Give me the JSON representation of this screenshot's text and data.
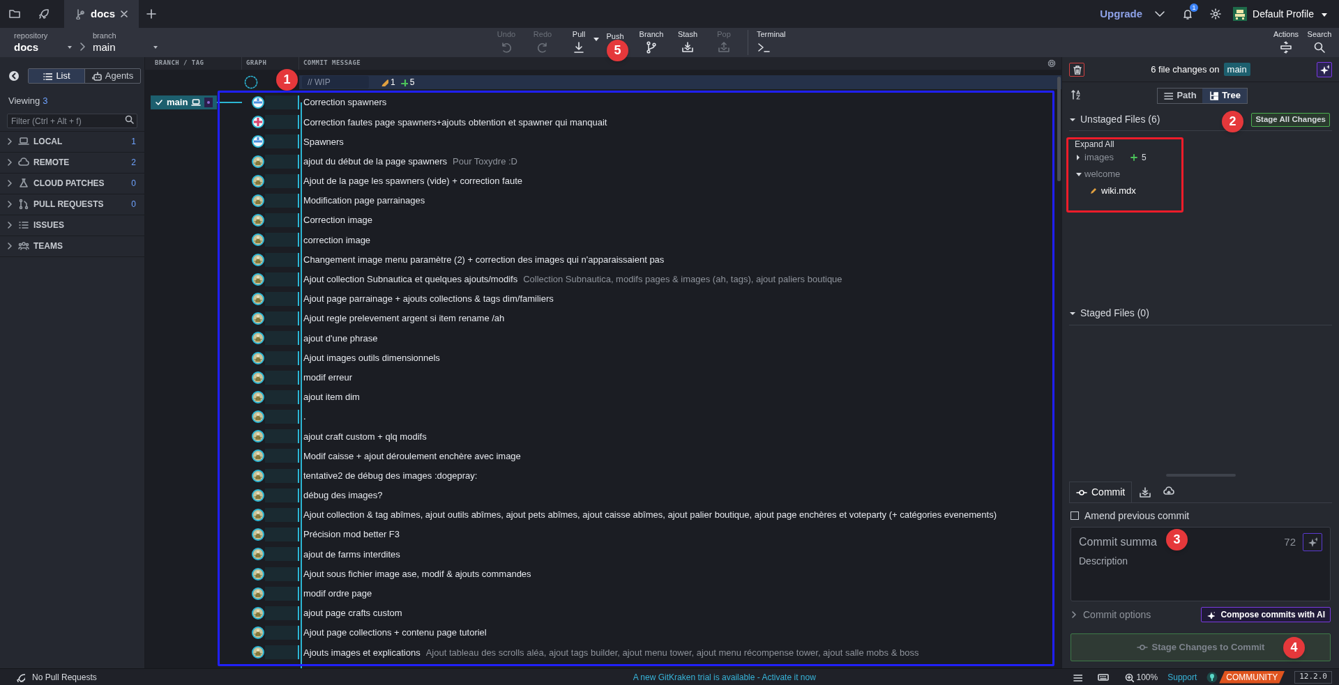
{
  "top_bar": {
    "tabs": [
      {
        "label": "docs",
        "selected": true
      }
    ],
    "upgrade": "Upgrade",
    "notifications": "1",
    "profile": "Default Profile"
  },
  "toolbar": {
    "repository_label": "repository",
    "repository": "docs",
    "branch_label": "branch",
    "branch": "main",
    "actions": [
      {
        "label": "Undo",
        "kind": "undo",
        "disabled": true
      },
      {
        "label": "Redo",
        "kind": "redo",
        "disabled": true
      },
      {
        "label": "Pull",
        "kind": "pull",
        "disabled": false
      },
      {
        "label": "Push",
        "kind": "push",
        "disabled": false
      },
      {
        "label": "Branch",
        "kind": "branch",
        "disabled": false
      },
      {
        "label": "Stash",
        "kind": "stash",
        "disabled": false
      },
      {
        "label": "Pop",
        "kind": "pop",
        "disabled": true
      },
      {
        "label": "Terminal",
        "kind": "terminal",
        "disabled": false
      }
    ],
    "right_actions": [
      {
        "label": "Actions",
        "kind": "actions"
      },
      {
        "label": "Search",
        "kind": "search"
      }
    ]
  },
  "sidebar": {
    "view_tabs": [
      {
        "label": "List",
        "selected": true
      },
      {
        "label": "Agents",
        "selected": false
      }
    ],
    "viewing_label": "Viewing",
    "viewing_count": "3",
    "filter_placeholder": "Filter (Ctrl + Alt + f)",
    "sections": [
      {
        "label": "LOCAL",
        "kind": "local",
        "count": "1"
      },
      {
        "label": "REMOTE",
        "kind": "remote",
        "count": "2"
      },
      {
        "label": "CLOUD PATCHES",
        "kind": "cloud",
        "count": "0"
      },
      {
        "label": "PULL REQUESTS",
        "kind": "pr",
        "count": "0"
      },
      {
        "label": "ISSUES",
        "kind": "issues"
      },
      {
        "label": "TEAMS",
        "kind": "teams"
      }
    ]
  },
  "graph": {
    "columns": [
      "BRANCH / TAG",
      "GRAPH",
      "COMMIT MESSAGE"
    ],
    "wip": {
      "placeholder": "// WIP",
      "modified": "1",
      "added": "5"
    },
    "branch_label": {
      "name": "main",
      "checked_out": true
    },
    "commits": [
      {
        "message": "Correction spawners",
        "kind": "blue"
      },
      {
        "message": "Correction fautes page spawners+ajouts obtention et spawner qui manquait",
        "kind": "pink"
      },
      {
        "message": "Spawners",
        "kind": "blue"
      },
      {
        "message": "ajout du début de la page spawners",
        "description": "Pour Toxydre :D",
        "kind": "photo"
      },
      {
        "message": "Ajout de la page les spawners (vide) + correction faute",
        "kind": "photo"
      },
      {
        "message": "Modification page parrainages",
        "kind": "photo"
      },
      {
        "message": "Correction image",
        "kind": "photo"
      },
      {
        "message": "correction image",
        "kind": "photo"
      },
      {
        "message": "Changement image menu paramètre (2) + correction des images qui n'apparaissaient pas",
        "kind": "photo"
      },
      {
        "message": "Ajout collection Subnautica et quelques ajouts/modifs",
        "description": "Collection Subnautica, modifs pages & images (ah, tags), ajout paliers boutique",
        "kind": "photo"
      },
      {
        "message": "Ajout page parrainage + ajouts collections & tags dim/familiers",
        "kind": "photo"
      },
      {
        "message": "Ajout regle prelevement argent si item rename /ah",
        "kind": "photo"
      },
      {
        "message": "ajout d'une phrase",
        "kind": "photo"
      },
      {
        "message": "Ajout images outils dimensionnels",
        "kind": "photo"
      },
      {
        "message": "modif erreur",
        "kind": "photo"
      },
      {
        "message": "ajout item dim",
        "kind": "photo"
      },
      {
        "message": ".",
        "kind": "photo"
      },
      {
        "message": "ajout craft custom + qlq modifs",
        "kind": "photo"
      },
      {
        "message": "Modif caisse + ajout déroulement enchère avec image",
        "kind": "photo"
      },
      {
        "message": "tentative2 de débug des images :dogepray:",
        "kind": "photo"
      },
      {
        "message": "débug des images?",
        "kind": "photo"
      },
      {
        "message": "Ajout collection & tag abîmes, ajout outils abîmes, ajout pets abîmes, ajout caisse abîmes, ajout palier boutique, ajout page enchères et voteparty (+ catégories evenements)",
        "kind": "photo"
      },
      {
        "message": "Précision mod better F3",
        "kind": "photo"
      },
      {
        "message": "ajout de farms interdites",
        "kind": "photo"
      },
      {
        "message": "Ajout sous fichier image ase, modif & ajouts commandes",
        "kind": "photo"
      },
      {
        "message": "modif ordre page",
        "kind": "photo"
      },
      {
        "message": "ajout page crafts custom",
        "kind": "photo"
      },
      {
        "message": "Ajout page collections + contenu page tutoriel",
        "kind": "photo"
      },
      {
        "message": "Ajouts images et explications",
        "description": "Ajout tableau des scrolls aléa, ajout tags builder, ajout menu tower, ajout menu récompense tower, ajout salle mobs & boss",
        "kind": "photo"
      }
    ]
  },
  "changes_panel": {
    "summary": "6 file changes on",
    "branch": "main",
    "view_modes": [
      {
        "label": "Path",
        "selected": false
      },
      {
        "label": "Tree",
        "selected": true
      }
    ],
    "unstaged": {
      "title": "Unstaged Files (6)",
      "expanded": true,
      "stage_all": "Stage All Changes",
      "expand_all": "Expand All",
      "tree": [
        {
          "name": "images",
          "expanded": false,
          "added": "5"
        },
        {
          "name": "welcome",
          "expanded": true,
          "children": [
            {
              "name": "wiki.mdx",
              "kind": "modified"
            }
          ]
        }
      ]
    },
    "staged": {
      "title": "Staged Files (0)",
      "expanded": true
    },
    "commit_tabs": [
      {
        "label": "Commit",
        "kind": "commit",
        "selected": true
      },
      {
        "kind": "stash",
        "selected": false
      },
      {
        "kind": "cloud",
        "selected": false
      }
    ],
    "amend": {
      "label": "Amend previous commit",
      "checked": false
    },
    "summary_placeholder": "Commit summa",
    "char_count": "72",
    "description_placeholder": "Description",
    "commit_options": {
      "label": "Commit options",
      "expanded": false
    },
    "compose_ai": "Compose commits with AI",
    "stage_button": "Stage Changes to Commit"
  },
  "status_bar": {
    "pull_requests": "No Pull Requests",
    "trial": "A new GitKraken trial is available - Activate it now",
    "zoom": "100%",
    "support": "Support",
    "edition": "COMMUNITY",
    "version": "12.2.0"
  },
  "callouts": [
    {
      "label": "1"
    },
    {
      "label": "2"
    },
    {
      "label": "3"
    },
    {
      "label": "4"
    },
    {
      "label": "5"
    }
  ]
}
